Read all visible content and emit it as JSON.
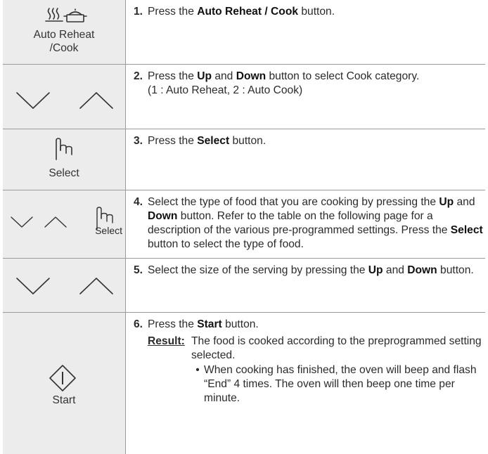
{
  "rows": [
    {
      "icon_label_line1": "Auto Reheat",
      "icon_label_line2": "/Cook",
      "icon": "steam-pot-icon",
      "num": "1.",
      "t1": "Press the ",
      "b1": "Auto Reheat / Cook",
      "t2": " button."
    },
    {
      "icon": "down-up-arrows-icon",
      "num": "2.",
      "t1": "Press the ",
      "b1": "Up",
      "t2": " and ",
      "b2": "Down",
      "t3": " button to select Cook category.",
      "line2": "(1 : Auto Reheat, 2 : Auto Cook)"
    },
    {
      "icon": "hand-pointer-icon",
      "icon_label": "Select",
      "num": "3.",
      "t1": "Press the ",
      "b1": "Select",
      "t2": " button."
    },
    {
      "icon": "down-up-select-icon",
      "icon_label": "Select",
      "num": "4.",
      "t1": "Select the type of food that you are cooking by pressing the ",
      "b1": "Up",
      "t2": " and ",
      "b2": "Down",
      "t3": " button. Refer to the table on the following page for a description of the various pre-programmed settings. Press the ",
      "b3": "Select",
      "t4": " button to select the type of food."
    },
    {
      "icon": "down-up-arrows-icon",
      "num": "5.",
      "t1": "Select the size of the serving by pressing the ",
      "b1": "Up",
      "t2": " and ",
      "b2": "Down",
      "t3": " button."
    },
    {
      "icon": "start-diamond-icon",
      "icon_label": "Start",
      "num": "6.",
      "t1": "Press the ",
      "b1": "Start",
      "t2": " button.",
      "result_label": "Result:",
      "result_text": "The food is cooked according to the preprogrammed setting selected.",
      "bullet_symbol": "•",
      "bullet_text": "When cooking has finished, the oven will beep and flash “End” 4 times. The oven will then beep one time per minute."
    }
  ]
}
